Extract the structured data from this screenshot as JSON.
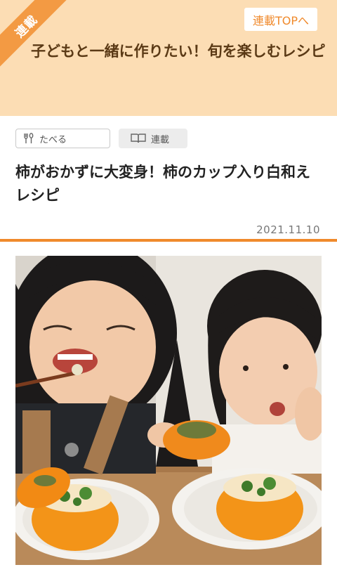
{
  "series": {
    "ribbon_label": "連載",
    "top_link_label": "連載TOPへ",
    "title": "子どもと一緒に作りたい！旬を楽しむレシピ"
  },
  "tags": [
    {
      "label": "たべる",
      "icon": "fork-spoon-icon"
    },
    {
      "label": "連載",
      "icon": "book-icon"
    }
  ],
  "article": {
    "title": "柿がおかずに大変身！柿のカップ入り白和えレシピ",
    "date": "2021.11.10"
  },
  "colors": {
    "banner_bg": "#fcddb4",
    "accent": "#f08a2c",
    "ribbon": "#f39a43",
    "title_brown": "#5b3a16"
  },
  "photo": {
    "icon": "hero-photo"
  }
}
